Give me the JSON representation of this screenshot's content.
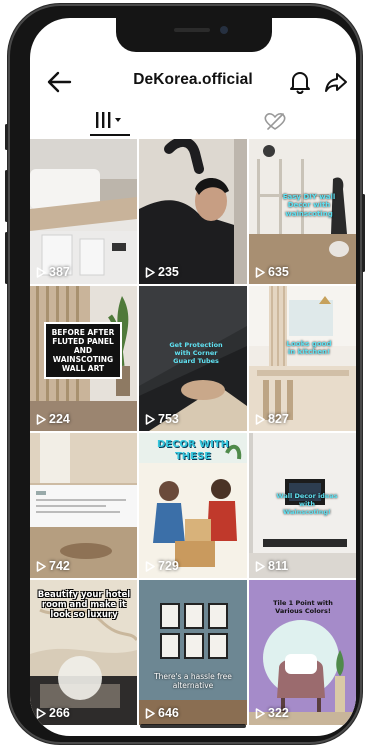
{
  "profile": {
    "username": "DeKorea.official"
  },
  "icons": {
    "back": "arrow-left-icon",
    "notifications": "bell-icon",
    "share": "share-arrow-icon",
    "videos_tab": "grid-bars-icon",
    "liked_tab": "heart-hidden-icon",
    "views": "play-icon"
  },
  "colors": {
    "text": "#111111",
    "phone_frame": "#151515",
    "accent_cyan": "#5fe0f0"
  },
  "videos": [
    {
      "views": "387",
      "caption": ""
    },
    {
      "views": "235",
      "caption": ""
    },
    {
      "views": "635",
      "caption": "Easy DIY wall Decor with wainscoting"
    },
    {
      "views": "224",
      "caption": "BEFORE AFTER FLUTED PANEL AND WAINSCOTING WALL ART"
    },
    {
      "views": "753",
      "caption": "Get Protection with Corner Guard Tubes"
    },
    {
      "views": "827",
      "caption": "Looks good in kitchen!"
    },
    {
      "views": "742",
      "caption": ""
    },
    {
      "views": "729",
      "caption": "DECOR WITH THESE"
    },
    {
      "views": "811",
      "caption": "Wall Decor ideas with Wainscoting!"
    },
    {
      "views": "266",
      "caption": "Beautify your hotel room and make it look so luxury"
    },
    {
      "views": "646",
      "caption": "There's a hassle free alternative"
    },
    {
      "views": "322",
      "caption": "Tile 1 Point with Various Colors!"
    }
  ]
}
